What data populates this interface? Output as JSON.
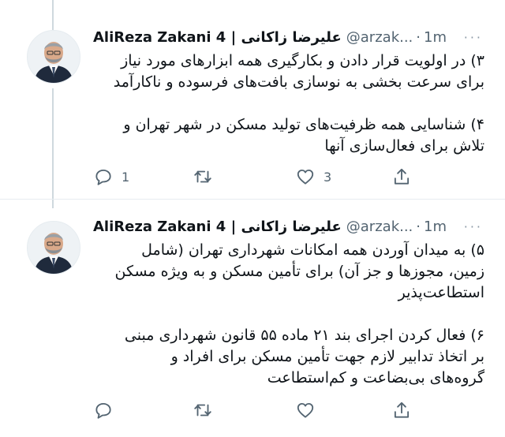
{
  "tweets": [
    {
      "author_name": "AliReza Zakani 4 | علیرضا زاکانی",
      "handle": "@arzak...",
      "separator": "·",
      "time": "1m",
      "more_label": "···",
      "paragraphs": [
        "۳) در اولویت قرار دادن و بکارگیری همه ابزارهای مورد نیاز\nبرای سرعت بخشی به نوسازی بافت‌های فرسوده و ناکارآمد",
        "۴) شناسایی همه ظرفیت‌های تولید مسکن در شهر تهران و\nتلاش برای فعال‌سازی آنها"
      ],
      "reply_count": "1",
      "retweet_count": "",
      "like_count": "3"
    },
    {
      "author_name": "AliReza Zakani 4 | علیرضا زاکانی",
      "handle": "@arzak...",
      "separator": "·",
      "time": "1m",
      "more_label": "···",
      "paragraphs": [
        "۵) به میدان آوردن همه امکانات شهرداری تهران (شامل\nزمین، مجوزها و جز آن) برای تأمین مسکن و به ویژه مسکن\nاستطاعت‌پذیر",
        "۶) فعال کردن اجرای بند ۲۱ ماده ۵۵ قانون شهرداری مبنی\nبر اتخاذ تدابیر لازم جهت تأمین مسکن برای افراد و\nگروه‌های بی‌بضاعت و کم‌استطاعت"
      ],
      "reply_count": "",
      "retweet_count": "",
      "like_count": ""
    }
  ],
  "icons": {
    "reply": "reply-icon",
    "retweet": "retweet-icon",
    "like": "heart-icon",
    "share": "share-icon",
    "more": "more-icon"
  },
  "colors": {
    "text": "#0f1419",
    "secondary": "#536471",
    "divider": "#e6ecf0",
    "thread_line": "#cfd9de"
  }
}
